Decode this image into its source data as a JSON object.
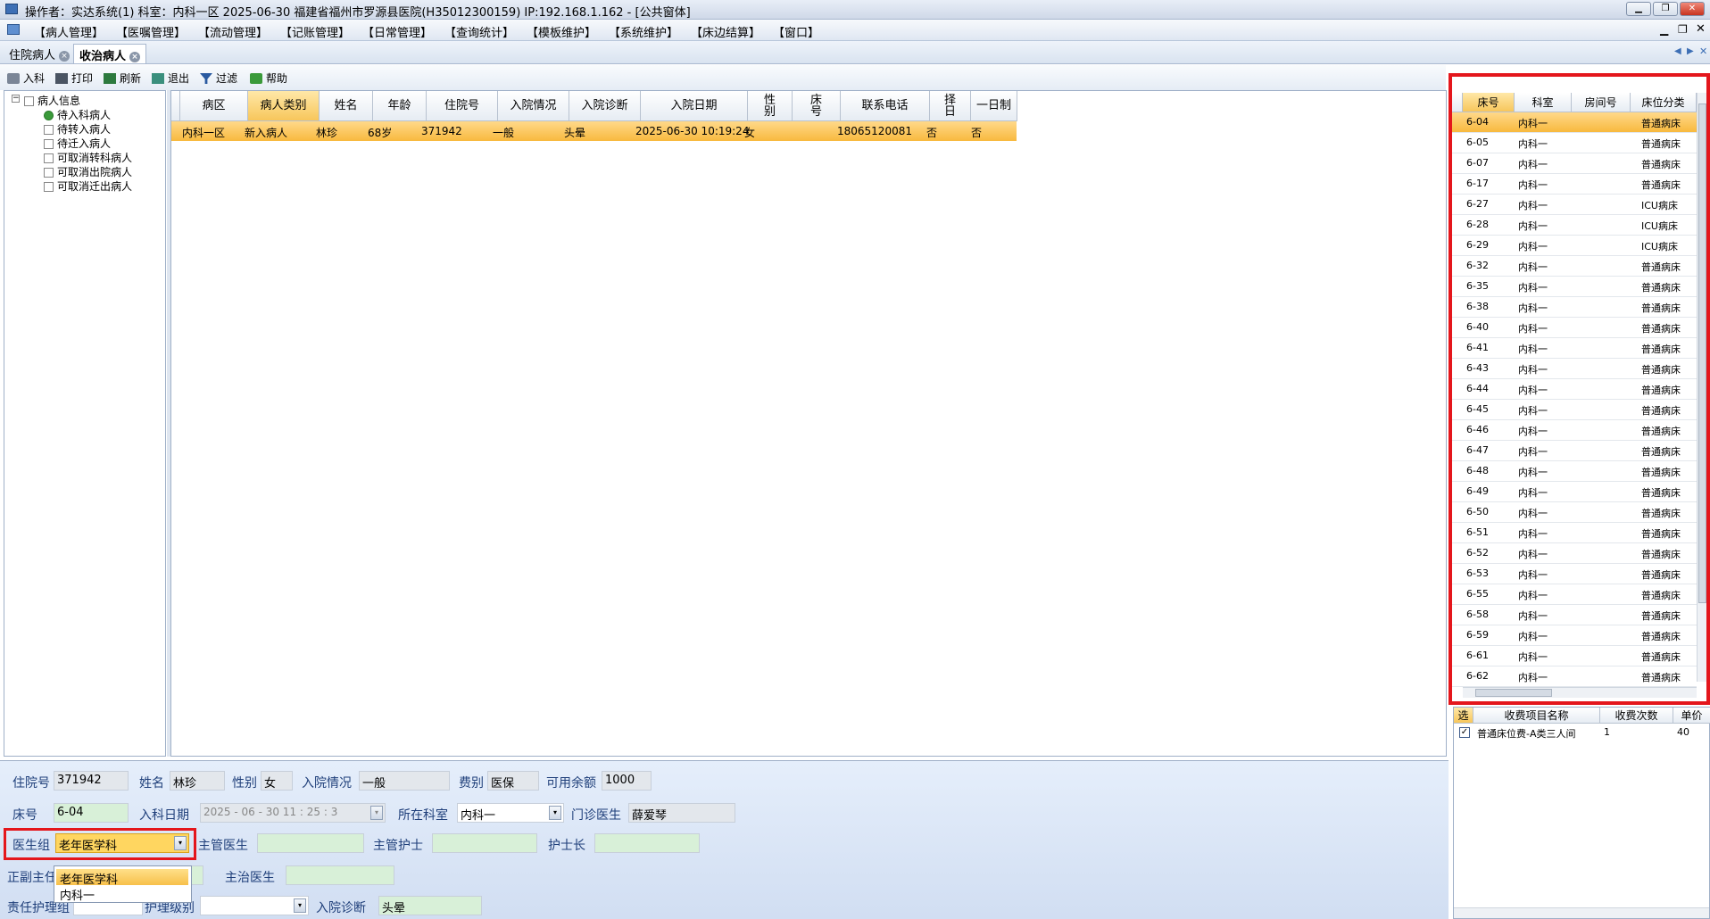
{
  "titlebar": {
    "text": "操作者：实达系统(1)  科室：内科一区  2025-06-30  福建省福州市罗源县医院(H35012300159) IP:192.168.1.162 - [公共窗体]"
  },
  "menu": [
    "【病人管理】",
    "【医嘱管理】",
    "【流动管理】",
    "【记账管理】",
    "【日常管理】",
    "【查询统计】",
    "【模板维护】",
    "【系统维护】",
    "【床边结算】",
    "【窗口】"
  ],
  "tabs": [
    {
      "label": "住院病人"
    },
    {
      "label": "收治病人"
    }
  ],
  "toolbar": [
    "入科",
    "打印",
    "刷新",
    "退出",
    "过滤",
    "帮助"
  ],
  "tree": {
    "root": "病人信息",
    "items": [
      "待入科病人",
      "待转入病人",
      "待迁入病人",
      "可取消转科病人",
      "可取消出院病人",
      "可取消迁出病人"
    ]
  },
  "grid": {
    "headers": [
      "病区",
      "病人类别",
      "姓名",
      "年龄",
      "住院号",
      "入院情况",
      "入院诊断",
      "入院日期",
      "性别",
      "床号",
      "联系电话",
      "择日",
      "一日制"
    ],
    "rows": [
      [
        "内科一区",
        "新入病人",
        "林珍",
        "68岁",
        "371942",
        "一般",
        "头晕",
        "2025-06-30 10:19:24",
        "女",
        "",
        "18065120081",
        "否",
        "否"
      ]
    ]
  },
  "beds": {
    "headers": [
      "床号",
      "科室",
      "房间号",
      "床位分类"
    ],
    "rows": [
      [
        "6-04",
        "内科一",
        "",
        "普通病床"
      ],
      [
        "6-05",
        "内科一",
        "",
        "普通病床"
      ],
      [
        "6-07",
        "内科一",
        "",
        "普通病床"
      ],
      [
        "6-17",
        "内科一",
        "",
        "普通病床"
      ],
      [
        "6-27",
        "内科一",
        "",
        "ICU病床"
      ],
      [
        "6-28",
        "内科一",
        "",
        "ICU病床"
      ],
      [
        "6-29",
        "内科一",
        "",
        "ICU病床"
      ],
      [
        "6-32",
        "内科一",
        "",
        "普通病床"
      ],
      [
        "6-35",
        "内科一",
        "",
        "普通病床"
      ],
      [
        "6-38",
        "内科一",
        "",
        "普通病床"
      ],
      [
        "6-40",
        "内科一",
        "",
        "普通病床"
      ],
      [
        "6-41",
        "内科一",
        "",
        "普通病床"
      ],
      [
        "6-43",
        "内科一",
        "",
        "普通病床"
      ],
      [
        "6-44",
        "内科一",
        "",
        "普通病床"
      ],
      [
        "6-45",
        "内科一",
        "",
        "普通病床"
      ],
      [
        "6-46",
        "内科一",
        "",
        "普通病床"
      ],
      [
        "6-47",
        "内科一",
        "",
        "普通病床"
      ],
      [
        "6-48",
        "内科一",
        "",
        "普通病床"
      ],
      [
        "6-49",
        "内科一",
        "",
        "普通病床"
      ],
      [
        "6-50",
        "内科一",
        "",
        "普通病床"
      ],
      [
        "6-51",
        "内科一",
        "",
        "普通病床"
      ],
      [
        "6-52",
        "内科一",
        "",
        "普通病床"
      ],
      [
        "6-53",
        "内科一",
        "",
        "普通病床"
      ],
      [
        "6-55",
        "内科一",
        "",
        "普通病床"
      ],
      [
        "6-58",
        "内科一",
        "",
        "普通病床"
      ],
      [
        "6-59",
        "内科一",
        "",
        "普通病床"
      ],
      [
        "6-61",
        "内科一",
        "",
        "普通病床"
      ],
      [
        "6-62",
        "内科一",
        "",
        "普通病床"
      ]
    ]
  },
  "fees": {
    "headers": [
      "选",
      "收费项目名称",
      "收费次数",
      "单价"
    ],
    "rows": [
      [
        "",
        "普通床位费-A类三人间",
        "1",
        "40"
      ]
    ]
  },
  "form": {
    "admission_no_label": "住院号",
    "admission_no": "371942",
    "name_label": "姓名",
    "name": "林珍",
    "gender_label": "性别",
    "gender": "女",
    "condition_label": "入院情况",
    "condition": "一般",
    "fee_type_label": "费别",
    "fee_type": "医保",
    "balance_label": "可用余额",
    "balance": "1000",
    "bed_label": "床号",
    "bed": "6-04",
    "enter_date_label": "入科日期",
    "enter_date": "2025 - 06 - 30    11 : 25 : 3",
    "dept_label": "所在科室",
    "dept": "内科一",
    "outpatient_doc_label": "门诊医生",
    "outpatient_doc": "薛爱琴",
    "doc_group_label": "医生组",
    "doc_group": "老年医学科",
    "attending_doc_label": "主管医生",
    "attending_doc": "",
    "attending_nurse_label": "主管护士",
    "attending_nurse": "",
    "head_nurse_label": "护士长",
    "head_nurse": "",
    "chief_label": "正副主任",
    "chief": "",
    "treating_doc_label": "主治医生",
    "treating_doc": "",
    "nurse_group_label": "责任护理组",
    "nurse_group": "",
    "care_level_label": "护理级别",
    "care_level": "",
    "diagnosis_label": "入院诊断",
    "diagnosis": "头晕",
    "dropdown_options": [
      "老年医学科",
      "内科一"
    ]
  }
}
